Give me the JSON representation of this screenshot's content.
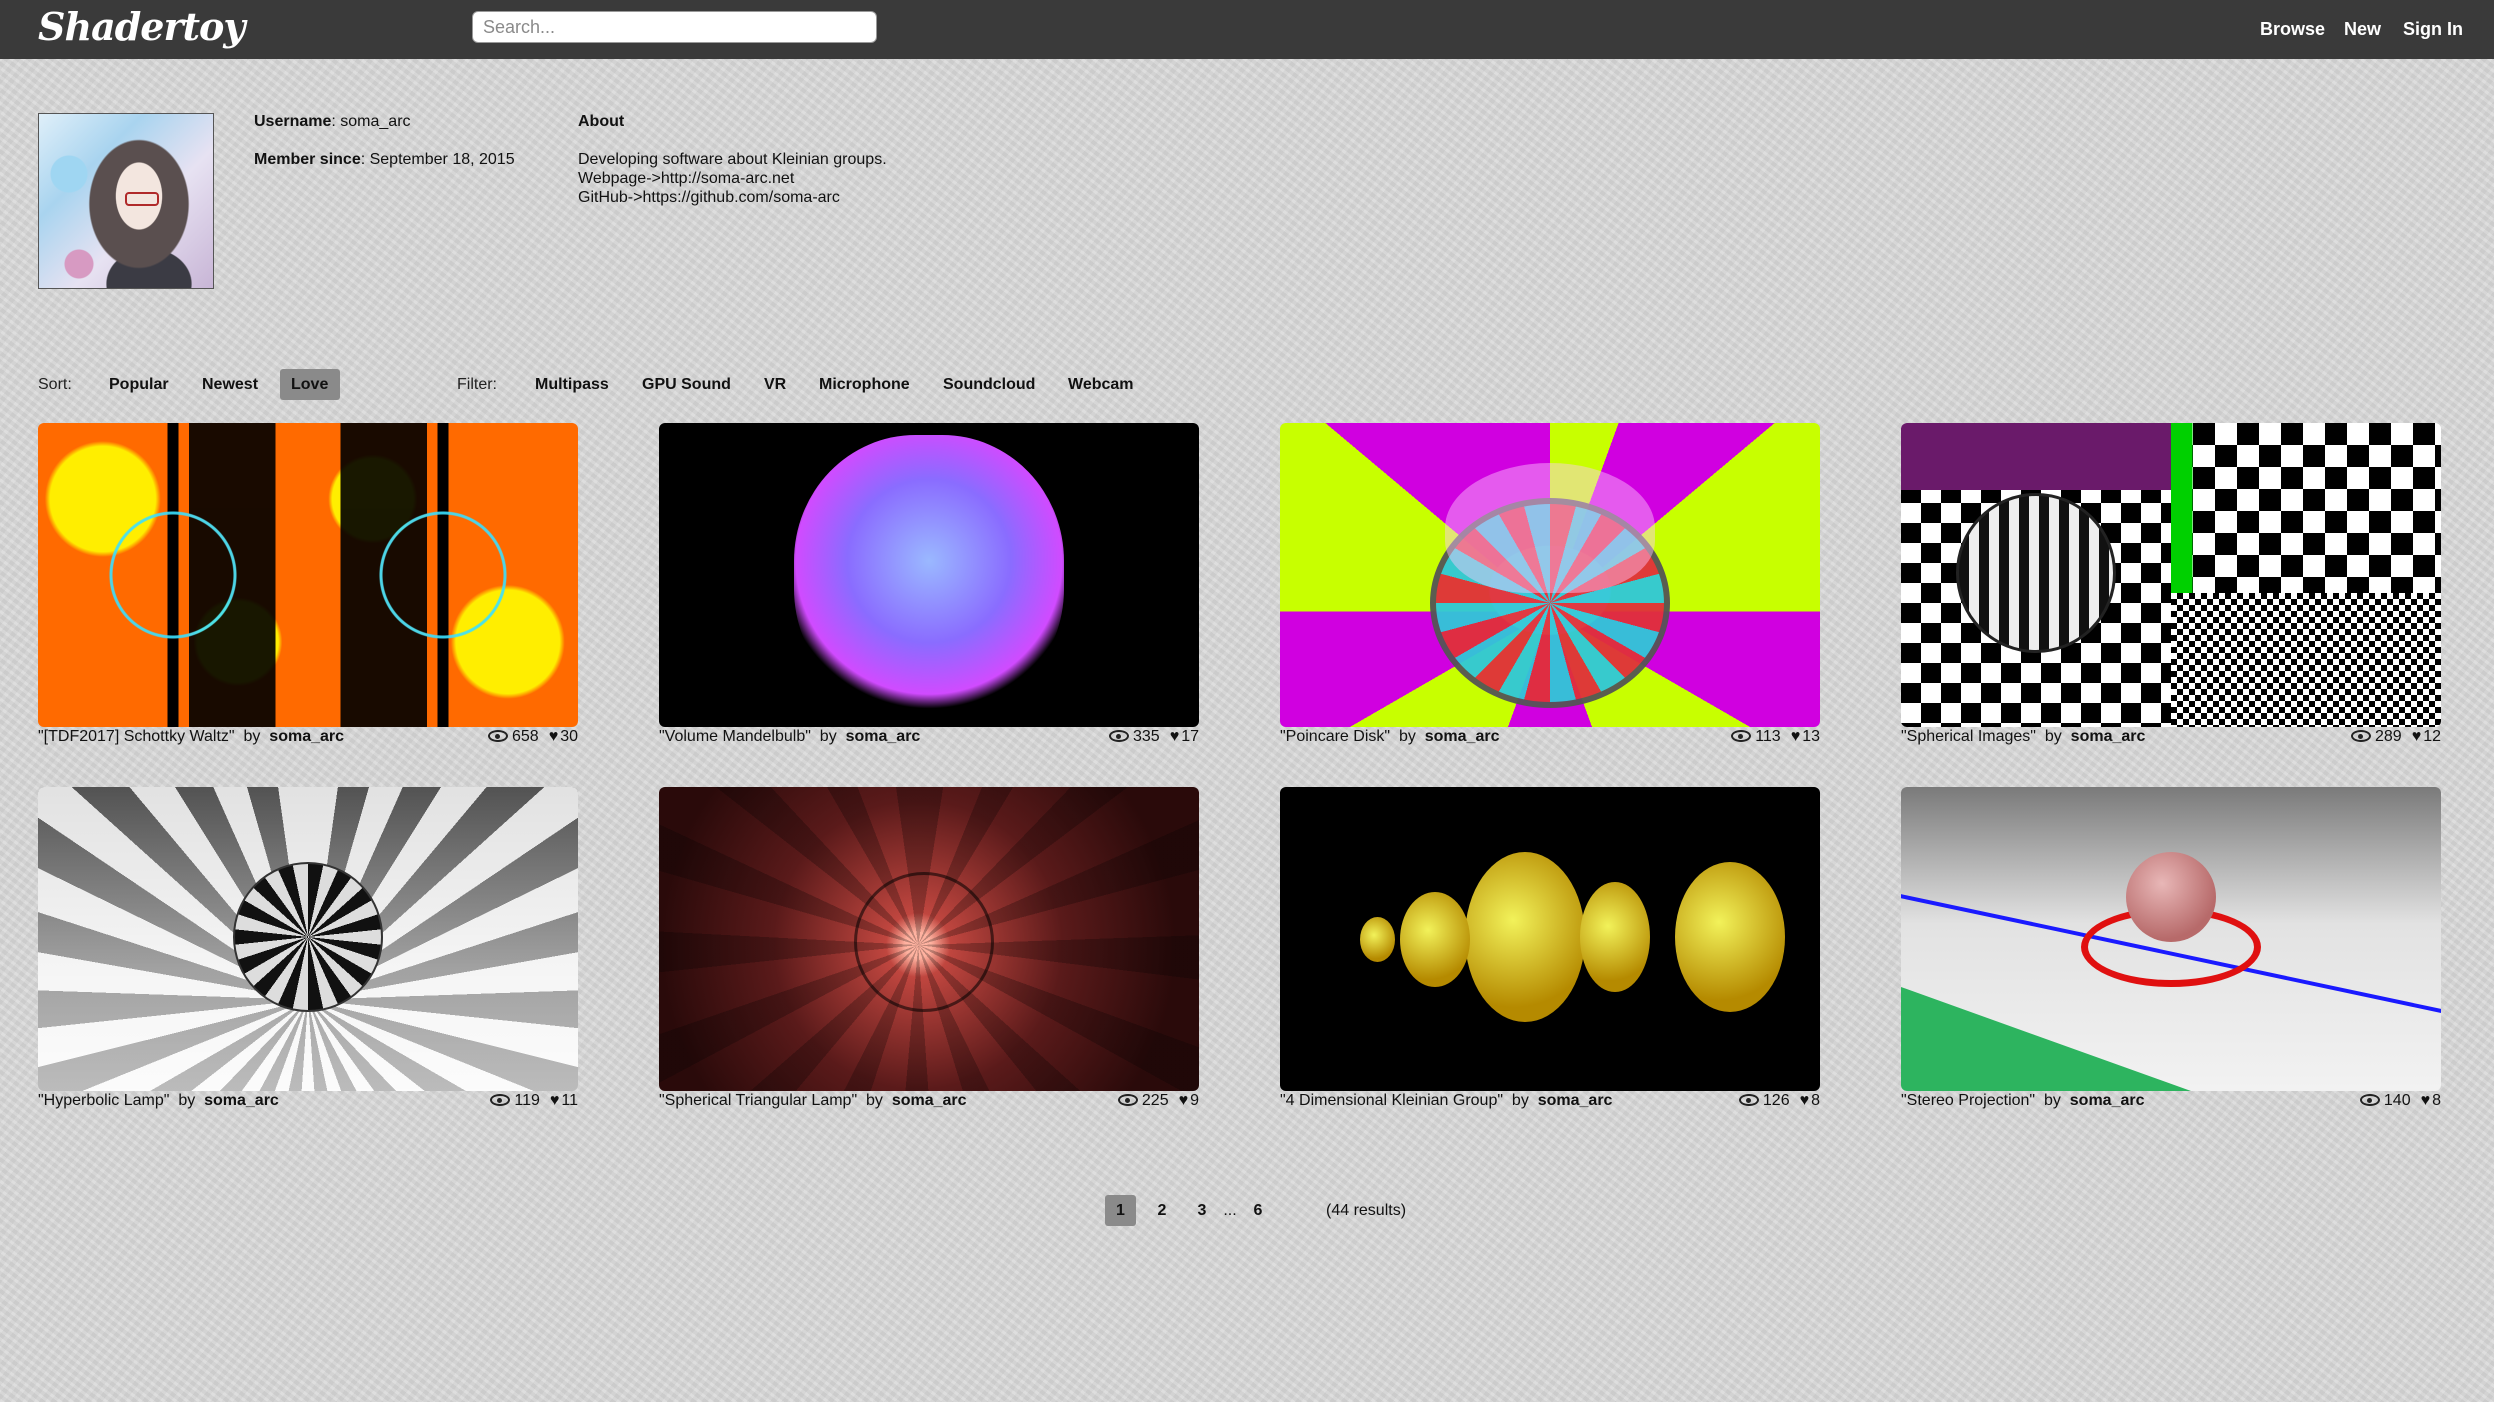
{
  "header": {
    "logo": "Shadertoy",
    "search_placeholder": "Search...",
    "nav": [
      "Browse",
      "New",
      "Sign In"
    ]
  },
  "profile": {
    "username_label": "Username",
    "username": "soma_arc",
    "member_label": "Member since",
    "member_since": "September 18, 2015",
    "about_label": "About",
    "about_lines": [
      "Developing software about Kleinian groups.",
      "Webpage->http://soma-arc.net",
      "GitHub->https://github.com/soma-arc"
    ]
  },
  "sort": {
    "label": "Sort:",
    "options": [
      "Popular",
      "Newest",
      "Love"
    ],
    "active": "Love"
  },
  "filter": {
    "label": "Filter:",
    "options": [
      "Multipass",
      "GPU Sound",
      "VR",
      "Microphone",
      "Soundcloud",
      "Webcam"
    ]
  },
  "by": "by",
  "shaders": [
    {
      "title": "\"[TDF2017] Schottky Waltz\"",
      "author": "soma_arc",
      "views": "658",
      "likes": "30"
    },
    {
      "title": "\"Volume Mandelbulb\"",
      "author": "soma_arc",
      "views": "335",
      "likes": "17"
    },
    {
      "title": "\"Poincare Disk\"",
      "author": "soma_arc",
      "views": "113",
      "likes": "13"
    },
    {
      "title": "\"Spherical Images\"",
      "author": "soma_arc",
      "views": "289",
      "likes": "12"
    },
    {
      "title": "\"Hyperbolic Lamp\"",
      "author": "soma_arc",
      "views": "119",
      "likes": "11"
    },
    {
      "title": "\"Spherical Triangular Lamp\"",
      "author": "soma_arc",
      "views": "225",
      "likes": "9"
    },
    {
      "title": "\"4 Dimensional Kleinian Group\"",
      "author": "soma_arc",
      "views": "126",
      "likes": "8"
    },
    {
      "title": "\"Stereo Projection\"",
      "author": "soma_arc",
      "views": "140",
      "likes": "8"
    }
  ],
  "pagination": {
    "pages": [
      "1",
      "2",
      "3",
      "...",
      "6"
    ],
    "current": "1",
    "results": "(44 results)"
  },
  "colors": {
    "header_bg": "#3a3a3a",
    "page_bg": "#d7d7d7",
    "active_chip": "#8a8a8a"
  }
}
